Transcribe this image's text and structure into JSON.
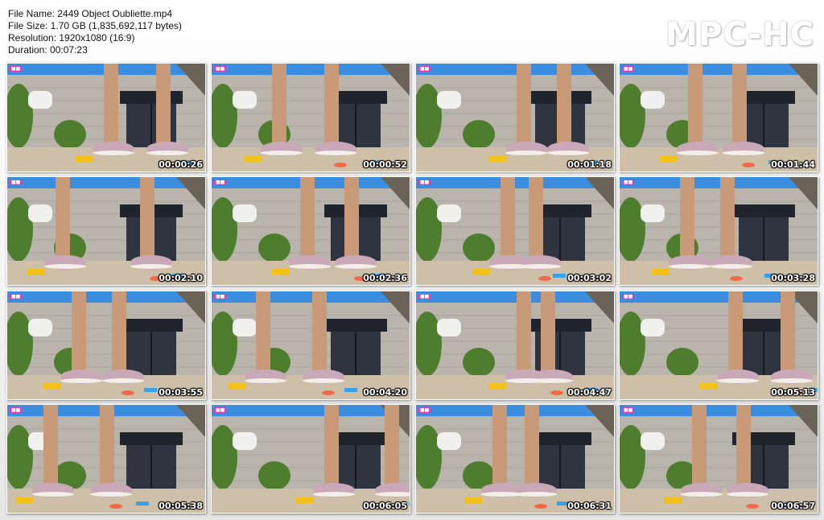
{
  "file_info": {
    "name_line": "File Name: 2449 Object Oubliette.mp4",
    "size_line": "File Size: 1.70 GB (1,835,692,117 bytes)",
    "resolution_line": "Resolution: 1920x1080 (16:9)",
    "duration_line": "Duration: 00:07:23"
  },
  "logo_text": "MPC-HC",
  "thumbnails": [
    {
      "time": "00:00:26"
    },
    {
      "time": "00:00:52"
    },
    {
      "time": "00:01:18"
    },
    {
      "time": "00:01:44"
    },
    {
      "time": "00:02:10"
    },
    {
      "time": "00:02:36"
    },
    {
      "time": "00:03:02"
    },
    {
      "time": "00:03:28"
    },
    {
      "time": "00:03:55"
    },
    {
      "time": "00:04:20"
    },
    {
      "time": "00:04:47"
    },
    {
      "time": "00:05:13"
    },
    {
      "time": "00:05:38"
    },
    {
      "time": "00:06:05"
    },
    {
      "time": "00:06:31"
    },
    {
      "time": "00:06:57"
    }
  ],
  "colors": {
    "sky": "#3b8de0",
    "wall": "#b9b5ad",
    "ground": "#cdbfa8",
    "grill": "#2e3440",
    "skin": "#c99a78",
    "shoe": "#c9a8b8",
    "plant": "#4f7d2e",
    "pot": "#f0f0ee"
  }
}
